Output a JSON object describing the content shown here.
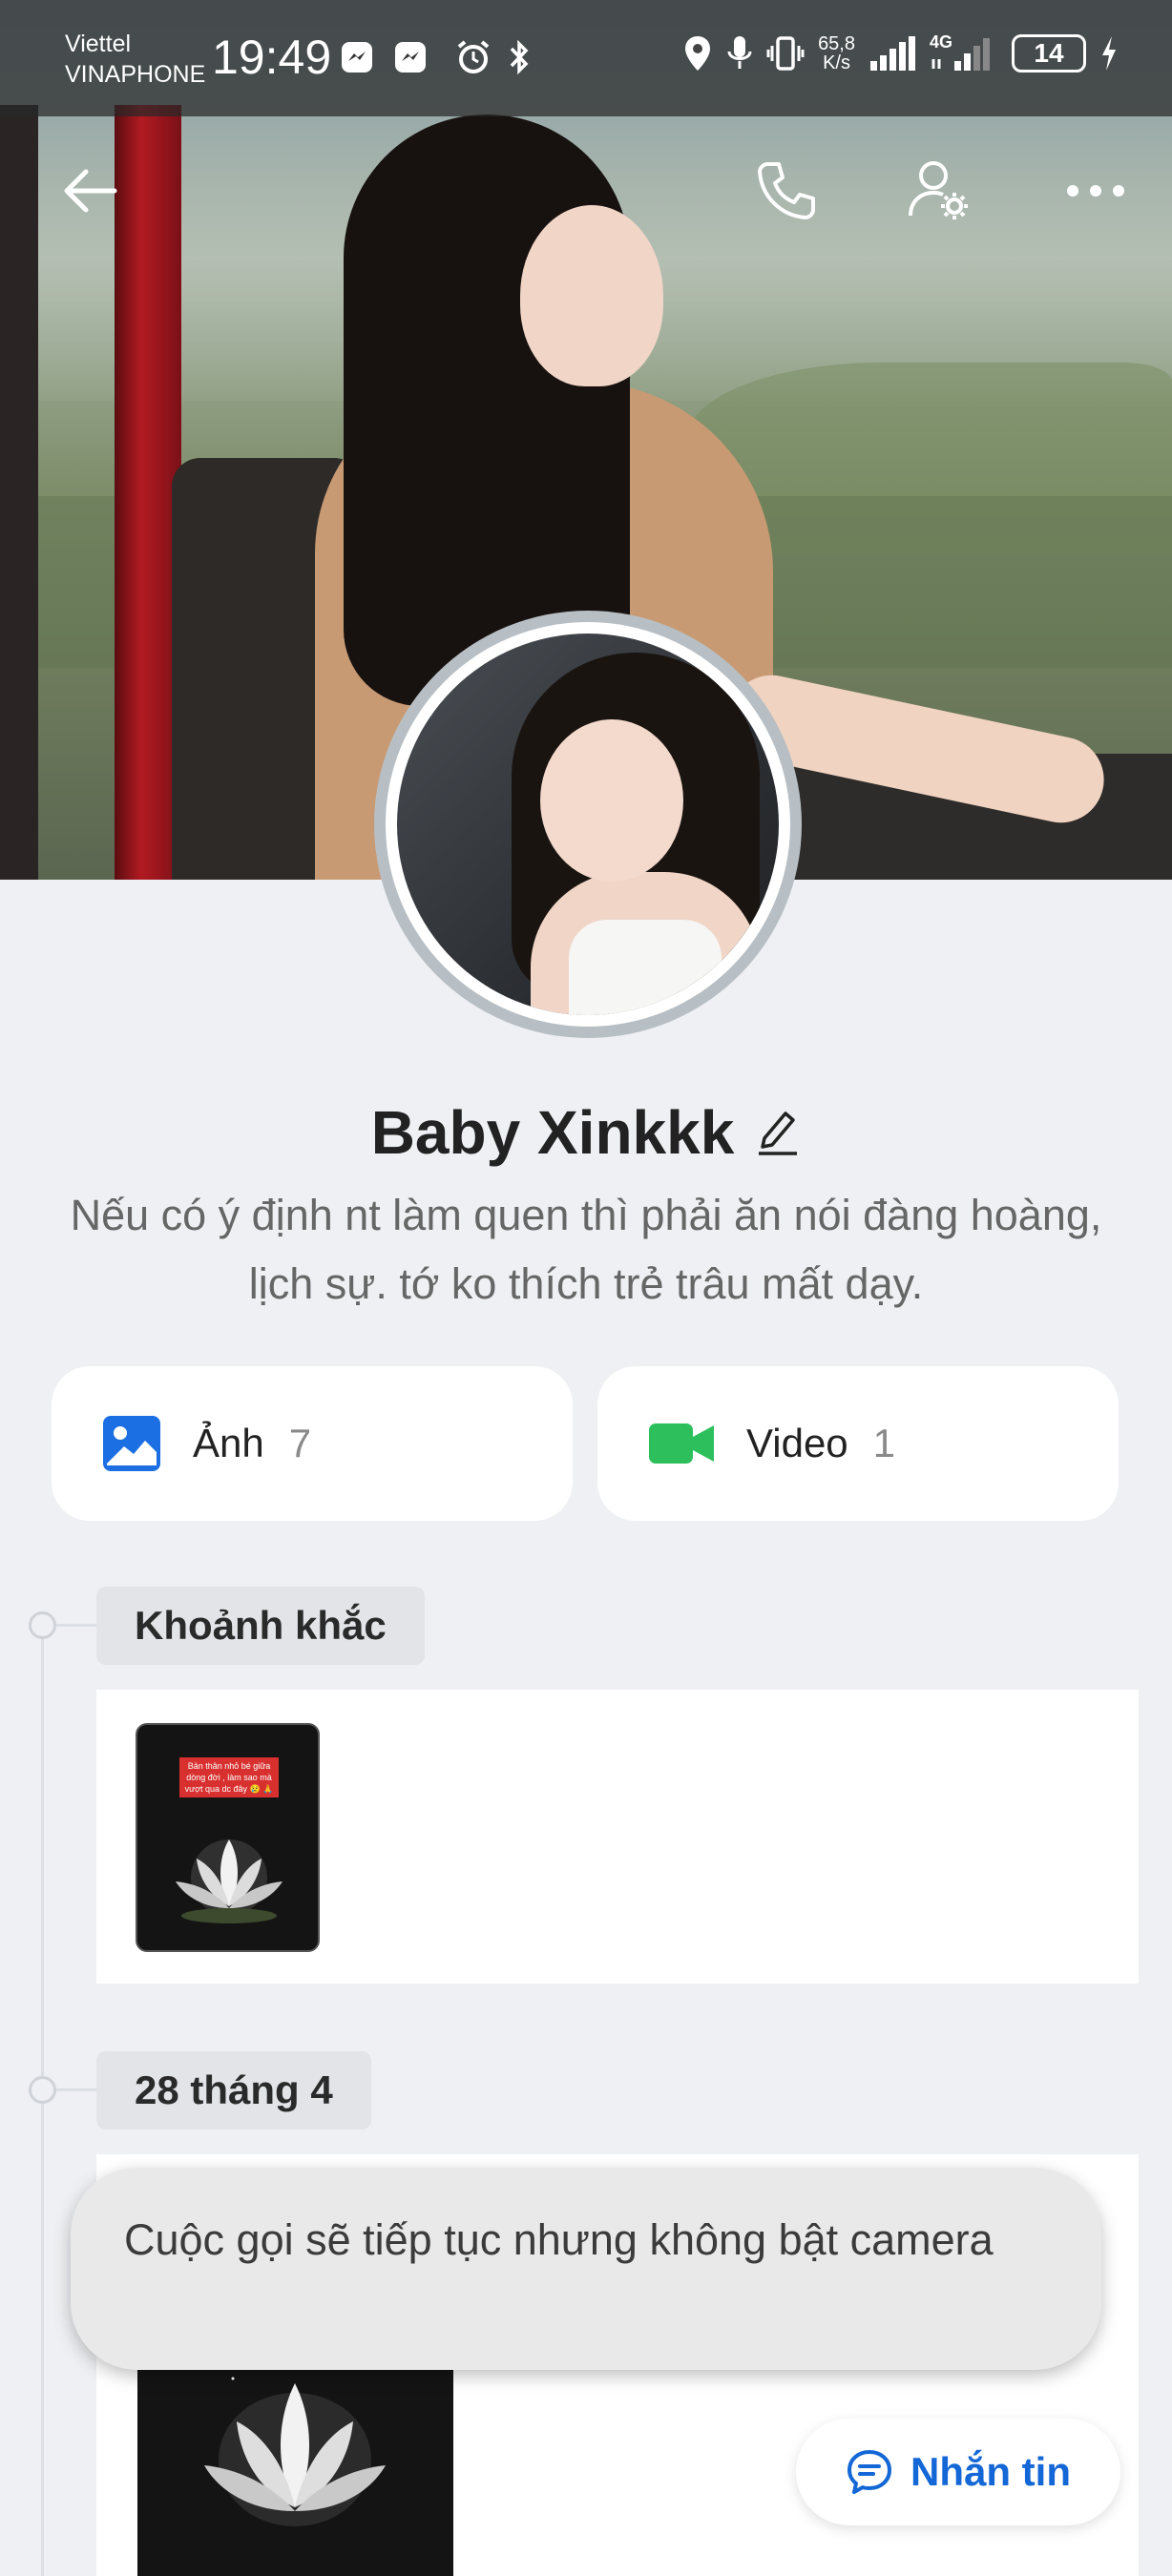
{
  "status_bar": {
    "carrier_1": "Viettel",
    "carrier_2": "VINAPHONE",
    "time": "19:49",
    "speed_value": "65,8",
    "speed_unit": "K/s",
    "network": "4G",
    "battery": "14"
  },
  "header": {
    "back_icon": "back-arrow-icon",
    "call_icon": "phone-icon",
    "settings_icon": "user-settings-icon",
    "more_icon": "more-icon"
  },
  "profile": {
    "name": "Baby Xinkkk",
    "bio": "Nếu có ý định nt làm quen thì phải ăn nói đàng hoàng, lịch sự. tớ ko thích trẻ trâu mất dạy."
  },
  "media": {
    "photos_label": "Ảnh",
    "photos_count": "7",
    "videos_label": "Video",
    "videos_count": "1"
  },
  "timeline": {
    "section_1_title": "Khoảnh khắc",
    "section_2_title": "28 tháng 4",
    "thumb_caption": "Bản thân nhỏ bé giữa dòng đời , làm sao mà vượt qua dc đây 😢 🙏"
  },
  "toast": {
    "message": "Cuộc gọi sẽ tiếp tục nhưng không bật camera"
  },
  "message_button": {
    "label": "Nhắn tin"
  },
  "colors": {
    "accent_blue": "#1467d6",
    "video_green": "#2ebf5d",
    "photo_blue": "#1b6fe3"
  }
}
